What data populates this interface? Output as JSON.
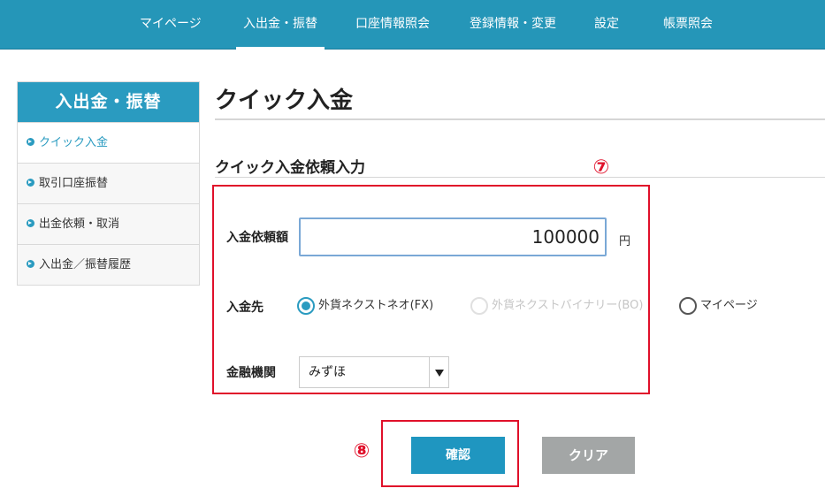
{
  "nav": {
    "items": [
      {
        "label": "マイページ",
        "active": false
      },
      {
        "label": "入出金・振替",
        "active": true
      },
      {
        "label": "口座情報照会",
        "active": false
      },
      {
        "label": "登録情報・変更",
        "active": false
      },
      {
        "label": "設定",
        "active": false
      },
      {
        "label": "帳票照会",
        "active": false
      }
    ]
  },
  "sidebar": {
    "header": "入出金・振替",
    "items": [
      {
        "label": "クイック入金",
        "active": true
      },
      {
        "label": "取引口座振替",
        "active": false
      },
      {
        "label": "出金依頼・取消",
        "active": false
      },
      {
        "label": "入出金／振替履歴",
        "active": false
      }
    ]
  },
  "main": {
    "title": "クイック入金",
    "section_title": "クイック入金依頼入力",
    "annotations": {
      "form": "⑦",
      "buttons": "⑧"
    },
    "form": {
      "amount_label": "入金依頼額",
      "amount_value": "100000",
      "amount_unit": "円",
      "destination_label": "入金先",
      "destinations": [
        {
          "label": "外貨ネクストネオ(FX)",
          "checked": true,
          "disabled": false
        },
        {
          "label": "外貨ネクストバイナリー(BO)",
          "checked": false,
          "disabled": true
        },
        {
          "label": "マイページ",
          "checked": false,
          "disabled": false
        }
      ],
      "bank_label": "金融機関",
      "bank_value": "みずほ"
    },
    "buttons": {
      "confirm": "確認",
      "clear": "クリア"
    }
  },
  "colors": {
    "nav_bg": "#2596b8",
    "accent": "#2a9bc0",
    "annotation": "#e0102a",
    "clear_button": "#a3a6a6"
  }
}
